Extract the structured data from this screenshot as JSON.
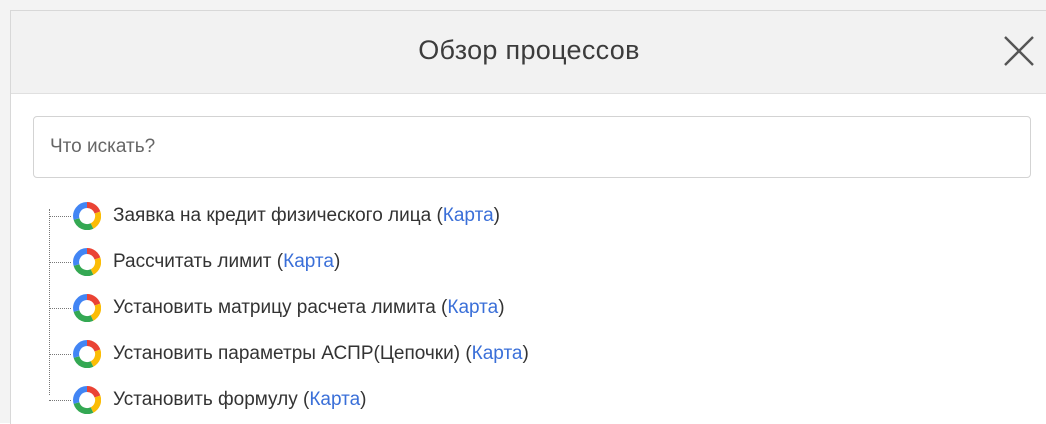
{
  "dialog": {
    "title": "Обзор процессов",
    "close_icon": "close-x-icon"
  },
  "search": {
    "placeholder": "Что искать?",
    "value": ""
  },
  "processes": [
    {
      "name": "Заявка на кредит физического лица",
      "link_label": "Карта",
      "icon": "process-ring-icon"
    },
    {
      "name": "Рассчитать лимит",
      "link_label": "Карта",
      "icon": "process-ring-icon"
    },
    {
      "name": "Установить матрицу расчета лимита",
      "link_label": "Карта",
      "icon": "process-ring-icon"
    },
    {
      "name": "Установить параметры АСПР(Цепочки)",
      "link_label": "Карта",
      "icon": "process-ring-icon"
    },
    {
      "name": "Установить формулу",
      "link_label": "Карта",
      "icon": "process-ring-icon"
    }
  ],
  "colors": {
    "link": "#3a6fd8",
    "icon_red": "#ea4335",
    "icon_yellow": "#fbbc05",
    "icon_green": "#34a853",
    "icon_blue": "#4285f4"
  }
}
